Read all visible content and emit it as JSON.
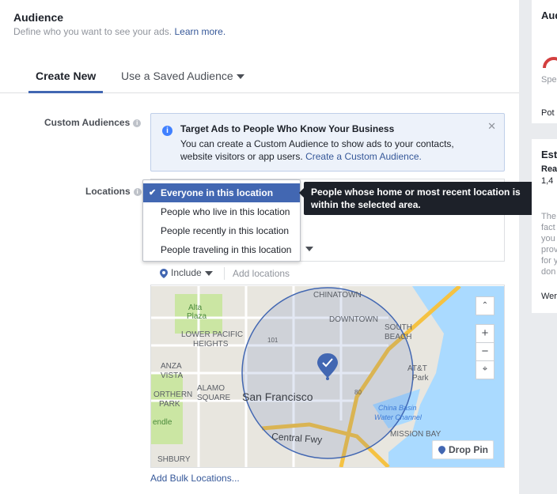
{
  "header": {
    "title": "Audience",
    "subtitle": "Define who you want to see your ads.",
    "learn_more": "Learn more."
  },
  "tabs": [
    {
      "label": "Create New"
    },
    {
      "label": "Use a Saved Audience"
    }
  ],
  "custom_audiences": {
    "label": "Custom Audiences",
    "info": "Target Ads to People Who Know Your Business",
    "body": "You can create a Custom Audience to show ads to your contacts, website visitors or app users.",
    "link": "Create a Custom Audience."
  },
  "locations": {
    "label": "Locations",
    "options": [
      "Everyone in this location",
      "People who live in this location",
      "People recently in this location",
      "People traveling in this location"
    ],
    "tooltip": "People whose home or most recent location is within the selected area.",
    "include": "Include",
    "add_placeholder": "Add locations",
    "bulk_link": "Add Bulk Locations...",
    "drop_pin": "Drop Pin"
  },
  "map": {
    "labels": [
      "CHINATOWN",
      "DOWNTOWN",
      "SOUTH",
      "BEACH",
      "Alta",
      "Plaza",
      "LOWER PACIFIC",
      "HEIGHTS",
      "ANZA",
      "VISTA",
      "ALAMO",
      "SQUARE",
      "ORTHERN",
      "PARK",
      "San Francisco",
      "AT&T",
      "Park",
      "China Basin",
      "Water Channel",
      "MISSION BAY",
      "Central Fwy",
      "101",
      "80",
      "endle",
      "SHBURY"
    ]
  },
  "sidebar": {
    "audience_title": "Aud",
    "spe": "Spe",
    "pot": "Pot",
    "est": "Est",
    "rea": "Rea",
    "num": "1,4",
    "line1": "The",
    "line2": "fact",
    "line3": "you",
    "line4": "prov",
    "line5": "for y",
    "line6": "don",
    "were": "Were"
  },
  "colors": {
    "accent": "#4267b2",
    "map_water": "#aadaff",
    "map_land": "#e8e6df"
  }
}
